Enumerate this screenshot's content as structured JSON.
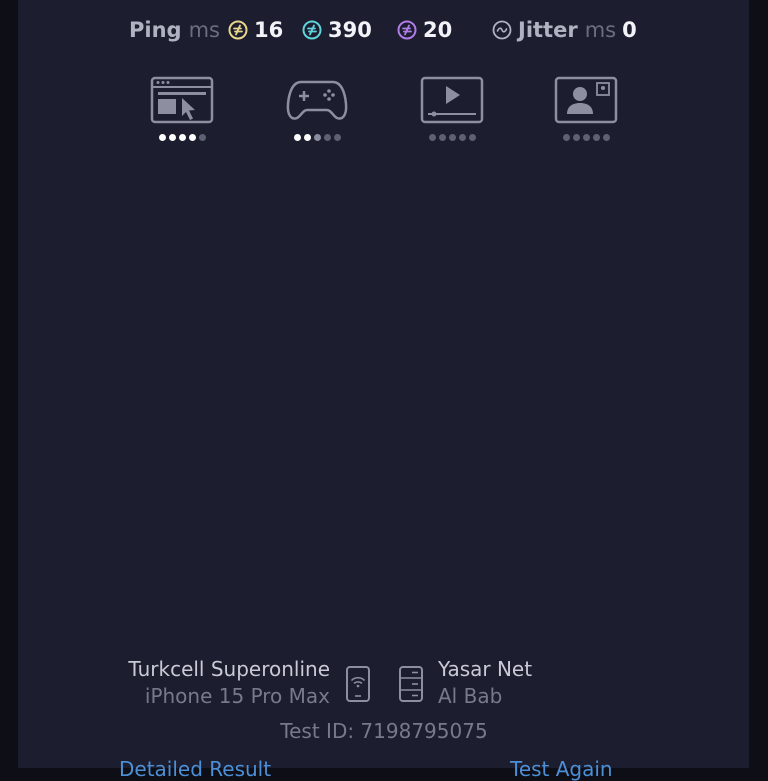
{
  "metrics": {
    "ping": {
      "label": "Ping",
      "unit": "ms",
      "icon": "ping-icon"
    },
    "idle": {
      "value": "16",
      "icon": "idle-ping-icon",
      "color": "#e8d68a"
    },
    "download": {
      "value": "390",
      "icon": "download-ping-icon",
      "color": "#5fd3d9"
    },
    "upload": {
      "value": "20",
      "icon": "upload-ping-icon",
      "color": "#b07ce8"
    },
    "jitter": {
      "label": "Jitter",
      "unit": "ms",
      "value": "0",
      "icon": "jitter-icon"
    }
  },
  "ratings": [
    {
      "name": "web-browsing",
      "icon": "web-browsing-icon",
      "level": 4,
      "max": 5
    },
    {
      "name": "gaming",
      "icon": "gaming-icon",
      "level": 2,
      "max": 5
    },
    {
      "name": "video-streaming",
      "icon": "video-streaming-icon",
      "level": 0,
      "max": 5
    },
    {
      "name": "video-chat",
      "icon": "video-chat-icon",
      "level": 0,
      "max": 5
    }
  ],
  "connection": {
    "isp": "Turkcell Superonline",
    "device": "iPhone 15 Pro Max",
    "server_name": "Yasar Net",
    "server_location": "Al Bab"
  },
  "test_id": "Test ID: 7198795075",
  "links": {
    "detailed": "Detailed Result",
    "again": "Test Again"
  },
  "colors": {
    "background": "#1c1d2e",
    "link": "#4d8fd6",
    "text": "#f2f3f8"
  }
}
